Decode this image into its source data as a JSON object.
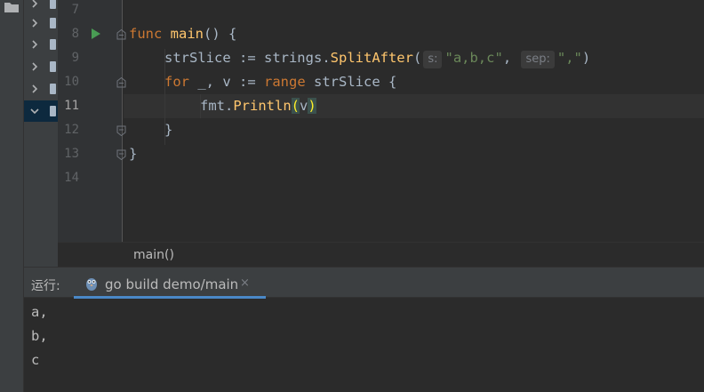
{
  "editor": {
    "line_numbers": [
      "7",
      "8",
      "9",
      "10",
      "11",
      "12",
      "13",
      "14"
    ],
    "current_line": "11",
    "code": {
      "line8": {
        "kw": "func",
        "name": "main",
        "rest": "() {"
      },
      "line9": {
        "var": "strSlice",
        "op": " := ",
        "pkg": "strings",
        "dot": ".",
        "fn": "SplitAfter",
        "open": "(",
        "hint1": "s:",
        "arg1": "\"a,b,c\"",
        "comma": ", ",
        "hint2": "sep:",
        "arg2": "\",\"",
        "close": ")"
      },
      "line10": {
        "kw1": "for",
        "mid": " _, v := ",
        "kw2": "range",
        "rest": " strSlice {"
      },
      "line11": {
        "pkg": "fmt",
        "dot": ".",
        "fn": "Println",
        "open": "(",
        "arg": "v",
        "close": ")"
      },
      "line12": {
        "text": "}"
      },
      "line13": {
        "text": "}"
      }
    }
  },
  "breadcrumb": {
    "label": "main()"
  },
  "run_panel": {
    "label": "运行:",
    "tab_label": "go build demo/main",
    "close_glyph": "×",
    "output": [
      "a,",
      "b,",
      "c"
    ]
  },
  "colors": {
    "keyword": "#cc7832",
    "function": "#ffc66d",
    "string": "#6a8759",
    "accent": "#4a88c7"
  },
  "icons": {
    "sidebar": "folder-icon",
    "tree": "chevron-right-icon",
    "tree_expanded": "chevron-down-icon",
    "gutter_run": "run-triangle-icon",
    "run_tab": "gopher-icon"
  }
}
